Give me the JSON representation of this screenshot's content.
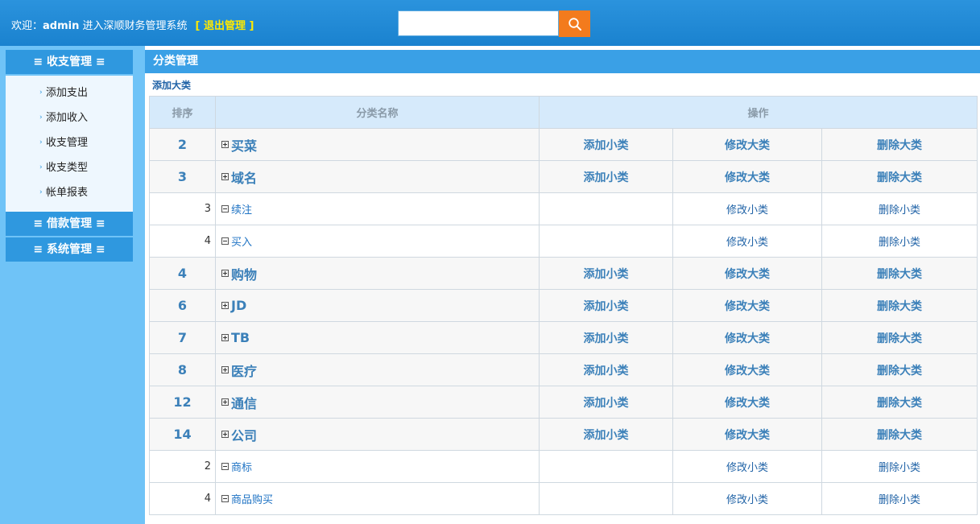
{
  "header": {
    "welcome_prefix": "欢迎：",
    "username": "admin",
    "welcome_suffix": " 进入深顺财务管理系统",
    "logout": "[ 退出管理 ]",
    "search_placeholder": "",
    "search_value": ""
  },
  "sidebar": {
    "menus": [
      {
        "label": "≡ 收支管理 ≡"
      },
      {
        "label": "≡ 借款管理 ≡"
      },
      {
        "label": "≡ 系统管理 ≡"
      }
    ],
    "items": [
      {
        "label": "添加支出"
      },
      {
        "label": "添加收入"
      },
      {
        "label": "收支管理"
      },
      {
        "label": "收支类型"
      },
      {
        "label": "帐单报表"
      }
    ]
  },
  "main": {
    "title": "分类管理",
    "add_category": "添加大类",
    "columns": {
      "sort": "排序",
      "name": "分类名称",
      "ops": "操作"
    },
    "ops": {
      "add_sub": "添加小类",
      "edit_major": "修改大类",
      "delete_major": "删除大类",
      "edit_sub": "修改小类",
      "delete_sub": "删除小类"
    },
    "rows": [
      {
        "type": "major",
        "sort": "2",
        "name": "买菜"
      },
      {
        "type": "major",
        "sort": "3",
        "name": "域名"
      },
      {
        "type": "minor",
        "sort": "3",
        "name": "续注"
      },
      {
        "type": "minor",
        "sort": "4",
        "name": "买入"
      },
      {
        "type": "major",
        "sort": "4",
        "name": "购物"
      },
      {
        "type": "major",
        "sort": "6",
        "name": "JD"
      },
      {
        "type": "major",
        "sort": "7",
        "name": "TB"
      },
      {
        "type": "major",
        "sort": "8",
        "name": "医疗"
      },
      {
        "type": "major",
        "sort": "12",
        "name": "通信"
      },
      {
        "type": "major",
        "sort": "14",
        "name": "公司"
      },
      {
        "type": "minor",
        "sort": "2",
        "name": "商标"
      },
      {
        "type": "minor",
        "sort": "4",
        "name": "商品购买"
      }
    ]
  },
  "colors": {
    "header_bg": "#1a82cf",
    "sidebar_bg": "#6fc3f7",
    "menu_header_bg": "#2f98df",
    "title_bar_bg": "#3aa0e6",
    "search_button": "#f37b1d",
    "logout_text": "#ffea00"
  }
}
